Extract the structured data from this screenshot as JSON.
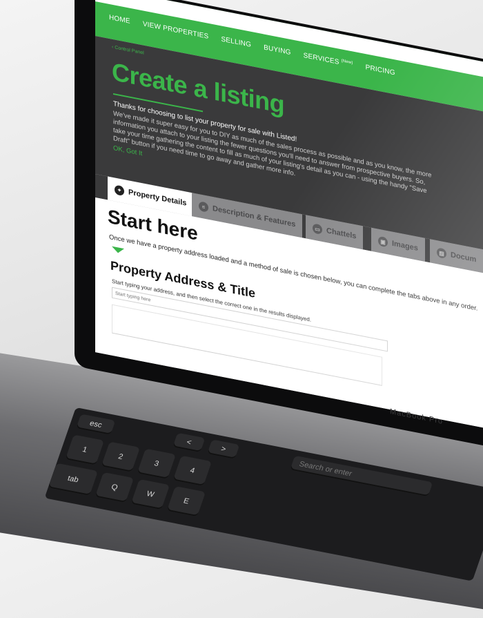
{
  "nav": {
    "items": [
      {
        "label": "HOME"
      },
      {
        "label": "VIEW PROPERTIES"
      },
      {
        "label": "SELLING"
      },
      {
        "label": "BUYING"
      },
      {
        "label": "SERVICES",
        "badge": "(New)"
      },
      {
        "label": "PRICING"
      }
    ]
  },
  "breadcrumb": "‹ Control Panel",
  "hero": {
    "title": "Create a listing",
    "lead": "Thanks for choosing to list your property for sale with Listed!",
    "body": "We've made it super easy for you to DIY as much of the sales process as possible and as you know, the more information you attach to your listing the fewer questions you'll need to answer from prospective buyers. So, take your time gathering the content to fill as much of your listing's detail as you can - using the handy \"Save Draft\" button if you need time to go away and gather more info.",
    "ok_link": "OK, Got It"
  },
  "tabs": [
    {
      "label": "Property Details",
      "icon": "location-pin-icon",
      "active": true
    },
    {
      "label": "Description & Features",
      "icon": "list-icon",
      "active": false
    },
    {
      "label": "Chattels",
      "icon": "sofa-icon",
      "active": false
    },
    {
      "label": "Images",
      "icon": "image-icon",
      "active": false
    },
    {
      "label": "Docum",
      "icon": "document-icon",
      "active": false
    }
  ],
  "content": {
    "start_title": "Start here",
    "start_desc": "Once we have a property address loaded and a method of sale is chosen below, you can complete the tabs above in any order.",
    "section_title": "Property Address & Title",
    "section_hint": "Start typing your address, and then select the correct one in the results displayed.",
    "address_placeholder": "Start typing here"
  },
  "keyboard": {
    "keys": [
      "esc",
      "<",
      ">",
      "1",
      "2",
      "3",
      "4",
      "tab",
      "Q",
      "W",
      "E"
    ],
    "search_hint": "Search or enter"
  },
  "brand": "MacBook Pro",
  "colors": {
    "accent": "#3bb54a",
    "hero_bg": "#3a3a3b",
    "tab_inactive": "#8a8a8c"
  }
}
